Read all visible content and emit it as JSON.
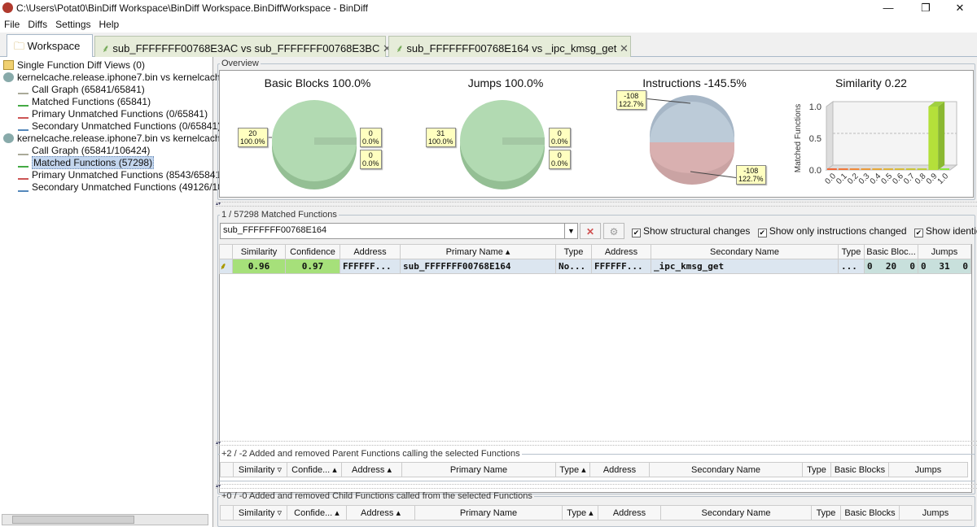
{
  "window": {
    "title": "C:\\Users\\Potat0\\BinDiff Workspace\\BinDiff Workspace.BinDiffWorkspace - BinDiff",
    "minimize": "—",
    "restore": "❐",
    "close": "✕"
  },
  "menu": [
    "File",
    "Diffs",
    "Settings",
    "Help"
  ],
  "tabs": [
    {
      "label": "Workspace",
      "icon": "folder-icon"
    },
    {
      "label": "sub_FFFFFFF00768E3AC vs sub_FFFFFFF00768E3BC",
      "icon": "call-graph-icon"
    },
    {
      "label": "sub_FFFFFFF00768E164 vs _ipc_kmsg_get",
      "icon": "call-graph-icon"
    }
  ],
  "tree": {
    "root": "Single Function Diff Views (0)",
    "diffs": [
      {
        "label": "kernelcache.release.iphone7.bin vs kernelcach",
        "children": [
          "Call Graph (65841/65841)",
          "Matched Functions (65841)",
          "Primary Unmatched Functions (0/65841)",
          "Secondary Unmatched Functions (0/65841)"
        ]
      },
      {
        "label": "kernelcache.release.iphone7.bin vs kernelcach",
        "children": [
          "Call Graph (65841/106424)",
          "Matched Functions (57298)",
          "Primary Unmatched Functions (8543/65841",
          "Secondary Unmatched Functions (49126/10"
        ]
      }
    ],
    "selected": "Matched Functions (57298)"
  },
  "overview": {
    "legend": "Overview",
    "charts": {
      "basic_blocks": {
        "title": "Basic Blocks 100.0%",
        "labels": [
          [
            "20",
            "100.0%"
          ],
          [
            "0",
            "0.0%"
          ],
          [
            "0",
            "0.0%"
          ]
        ]
      },
      "jumps": {
        "title": "Jumps 100.0%",
        "labels": [
          [
            "31",
            "100.0%"
          ],
          [
            "0",
            "0.0%"
          ],
          [
            "0",
            "0.0%"
          ]
        ]
      },
      "instructions": {
        "title": "Instructions -145.5%",
        "labels": [
          [
            "-108",
            "122.7%"
          ],
          [
            "-108",
            "122.7%"
          ]
        ]
      },
      "similarity": {
        "title": "Similarity 0.22",
        "ylabel": "Matched Functions",
        "yticks": [
          "0.0",
          "0.5",
          "1.0"
        ],
        "categories": [
          "0.0",
          "0.1",
          "0.2",
          "0.3",
          "0.4",
          "0.5",
          "0.6",
          "0.7",
          "0.8",
          "0.9",
          "1.0"
        ],
        "values": [
          0,
          0,
          0,
          0,
          0,
          0,
          0,
          0,
          0,
          1,
          0
        ],
        "ylim": [
          0,
          1.0
        ]
      }
    },
    "colors": {
      "green": "#a8d4a8",
      "blue": "#b4c4d4",
      "red": "#d4aeae"
    }
  },
  "matched": {
    "legend": "1 / 57298 Matched Functions",
    "search_value": "sub_FFFFFFF00768E164",
    "checkboxes": [
      "Show structural changes",
      "Show only instructions changed",
      "Show identical"
    ],
    "columns": [
      "",
      "Similarity",
      "Confidence",
      "Address",
      "Primary Name ▴",
      "Type",
      "Address",
      "Secondary Name",
      "Type",
      "Basic Bloc...",
      "Jumps"
    ],
    "rows": [
      {
        "similarity": "0.96",
        "confidence": "0.97",
        "paddr": "FFFFFF...",
        "pname": "sub_FFFFFFF00768E164",
        "ptype": "No...",
        "saddr": "FFFFFF...",
        "sname": "_ipc_kmsg_get",
        "stype": "...",
        "bb": [
          "0",
          "20",
          "0"
        ],
        "jumps": [
          "0",
          "31",
          "0"
        ]
      }
    ]
  },
  "parents": {
    "legend": "+2 / -2 Added and removed Parent Functions calling the selected Functions",
    "columns": [
      "",
      "Similarity ▿",
      "Confide... ▴",
      "Address ▴",
      "Primary Name",
      "Type ▴",
      "Address",
      "Secondary Name",
      "Type",
      "Basic Blocks",
      "Jumps"
    ]
  },
  "children": {
    "legend": "+0 / -0 Added and removed Child Functions called from the selected Functions",
    "columns": [
      "",
      "Similarity ▿",
      "Confide... ▴",
      "Address ▴",
      "Primary Name",
      "Type ▴",
      "Address",
      "Secondary Name",
      "Type",
      "Basic Blocks",
      "Jumps"
    ]
  }
}
